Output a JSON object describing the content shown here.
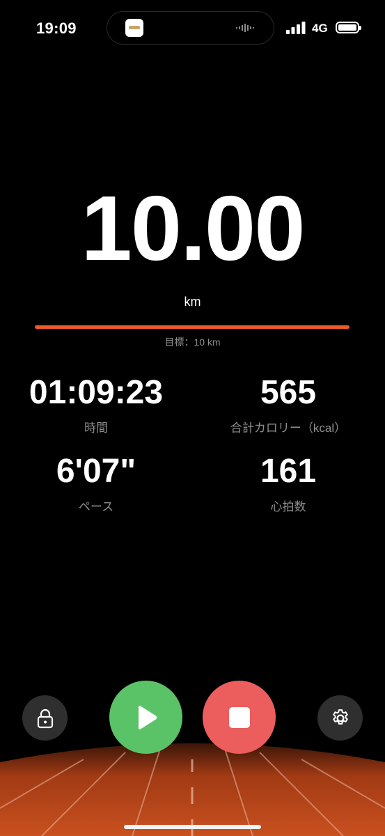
{
  "status_bar": {
    "time": "19:09",
    "network": "4G",
    "icons": [
      "app-icon",
      "audio-wave-icon",
      "signal-icon",
      "battery-icon"
    ]
  },
  "workout": {
    "distance": "10.00",
    "unit": "km",
    "goal_label": "目標：10 km",
    "goal_progress": 1.0
  },
  "stats": [
    {
      "value": "01:09:23",
      "label": "時間"
    },
    {
      "value": "565",
      "label": "合計カロリー（kcal）"
    },
    {
      "value": "6'07\"",
      "label": "ペース"
    },
    {
      "value": "161",
      "label": "心拍数"
    }
  ],
  "controls": {
    "lock_icon": "lock-icon",
    "play_icon": "play-icon",
    "stop_icon": "stop-icon",
    "settings_icon": "gear-icon"
  },
  "colors": {
    "background": "#000000",
    "accent": "#ee5a2a",
    "play": "#5bc367",
    "stop": "#ec5d5d",
    "secondary_text": "#8e8e8e",
    "track": "#c2481c"
  }
}
